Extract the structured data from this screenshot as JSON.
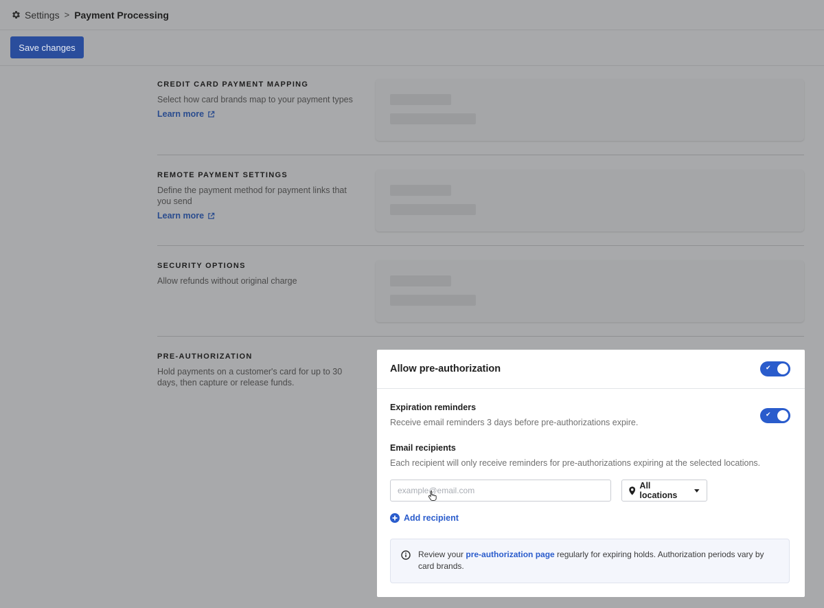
{
  "breadcrumb": {
    "root": "Settings",
    "separator": ">",
    "current": "Payment Processing",
    "icon": "gear-icon"
  },
  "toolbar": {
    "save_label": "Save changes",
    "accent": "#2a4d9c"
  },
  "sections": {
    "credit_card": {
      "title": "CREDIT CARD PAYMENT MAPPING",
      "description": "Select how card brands map to your payment types",
      "link": "Learn more"
    },
    "remote_payment": {
      "title": "REMOTE PAYMENT SETTINGS",
      "description": "Define the payment method for payment links that you send",
      "link": "Learn more"
    },
    "security": {
      "title": "SECURITY OPTIONS",
      "description": "Allow refunds without original charge"
    },
    "preauth": {
      "title": "PRE-AUTHORIZATION",
      "description": "Hold payments on a customer's card for up to 30 days, then capture or release funds."
    }
  },
  "preauth_card": {
    "header_title": "Allow pre-authorization",
    "header_toggle_on": true,
    "reminders_title": "Expiration reminders",
    "reminders_desc": "Receive email reminders 3 days before pre-authorizations expire.",
    "reminders_toggle_on": true,
    "recipients_title": "Email recipients",
    "recipients_desc": "Each recipient will only receive reminders for pre-authorizations expiring at the selected locations.",
    "email_placeholder": "example@email.com",
    "location_value": "All locations",
    "add_recipient_label": "Add recipient",
    "info_text_before": "Review your ",
    "info_link": "pre-authorization page",
    "info_text_after": " regularly for expiring holds. Authorization periods vary by card brands.",
    "toggle_color": "#2a5ccc"
  }
}
